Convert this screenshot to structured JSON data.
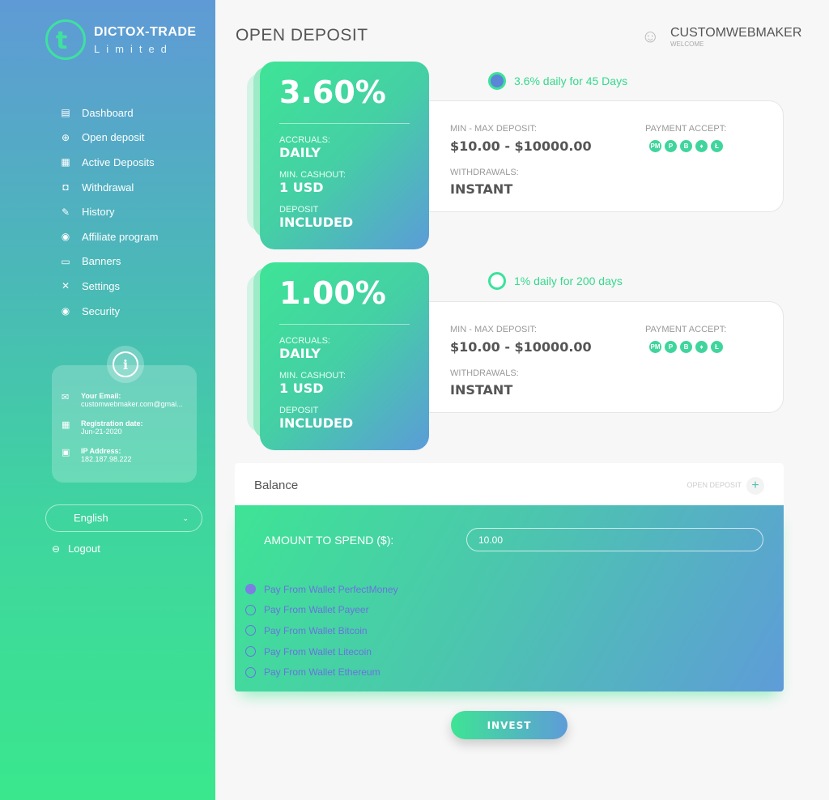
{
  "brand": {
    "title": "DICTOX-TRADE",
    "subtitle": "Limited",
    "mark": "t"
  },
  "nav": [
    {
      "label": "Dashboard",
      "icon": "▤"
    },
    {
      "label": "Open deposit",
      "icon": "⊕"
    },
    {
      "label": "Active Deposits",
      "icon": "▦"
    },
    {
      "label": "Withdrawal",
      "icon": "◘"
    },
    {
      "label": "History",
      "icon": "✎"
    },
    {
      "label": "Affiliate program",
      "icon": "◉"
    },
    {
      "label": "Banners",
      "icon": "▭"
    },
    {
      "label": "Settings",
      "icon": "✕"
    },
    {
      "label": "Security",
      "icon": "◉"
    }
  ],
  "info": {
    "badge": "i",
    "email_label": "Your Email:",
    "email": "customwebmaker.com@gmai...",
    "reg_label": "Registration date:",
    "reg": "Jun-21-2020",
    "ip_label": "IP Address:",
    "ip": "182.187.98.222"
  },
  "language": "English",
  "logout": "Logout",
  "header": {
    "title": "OPEN DEPOSIT",
    "user": "CUSTOMWEBMAKER",
    "welcome": "WELCOME"
  },
  "plans": [
    {
      "label": "3.6% daily for 45 Days",
      "rate": "3.60%",
      "selected": true,
      "accruals_label": "ACCRUALS:",
      "accruals": "DAILY",
      "cashout_label": "MIN. CASHOUT:",
      "cashout": "1 USD",
      "deposit_label": "DEPOSIT",
      "deposit": "INCLUDED",
      "minmax_label": "MIN - MAX DEPOSIT:",
      "minmax": "$10.00 - $10000.00",
      "withdraw_label": "WITHDRAWALS:",
      "withdraw": "INSTANT",
      "payment_label": "PAYMENT ACCEPT:"
    },
    {
      "label": "1% daily for 200 days",
      "rate": "1.00%",
      "selected": false,
      "accruals_label": "ACCRUALS:",
      "accruals": "DAILY",
      "cashout_label": "MIN. CASHOUT:",
      "cashout": "1 USD",
      "deposit_label": "DEPOSIT",
      "deposit": "INCLUDED",
      "minmax_label": "MIN - MAX DEPOSIT:",
      "minmax": "$10.00 - $10000.00",
      "withdraw_label": "WITHDRAWALS:",
      "withdraw": "INSTANT",
      "payment_label": "PAYMENT ACCEPT:"
    }
  ],
  "coins": [
    "PM",
    "P",
    "B",
    "♦",
    "Ł"
  ],
  "balance": {
    "label": "Balance",
    "open_deposit": "OPEN DEPOSIT",
    "plus": "+"
  },
  "form": {
    "amount_label": "AMOUNT TO SPEND ($):",
    "amount_value": "10.00"
  },
  "wallets": [
    {
      "label": "Pay From Wallet PerfectMoney",
      "selected": true
    },
    {
      "label": "Pay From Wallet Payeer",
      "selected": false
    },
    {
      "label": "Pay From Wallet Bitcoin",
      "selected": false
    },
    {
      "label": "Pay From Wallet Litecoin",
      "selected": false
    },
    {
      "label": "Pay From Wallet Ethereum",
      "selected": false
    }
  ],
  "invest_label": "INVEST"
}
